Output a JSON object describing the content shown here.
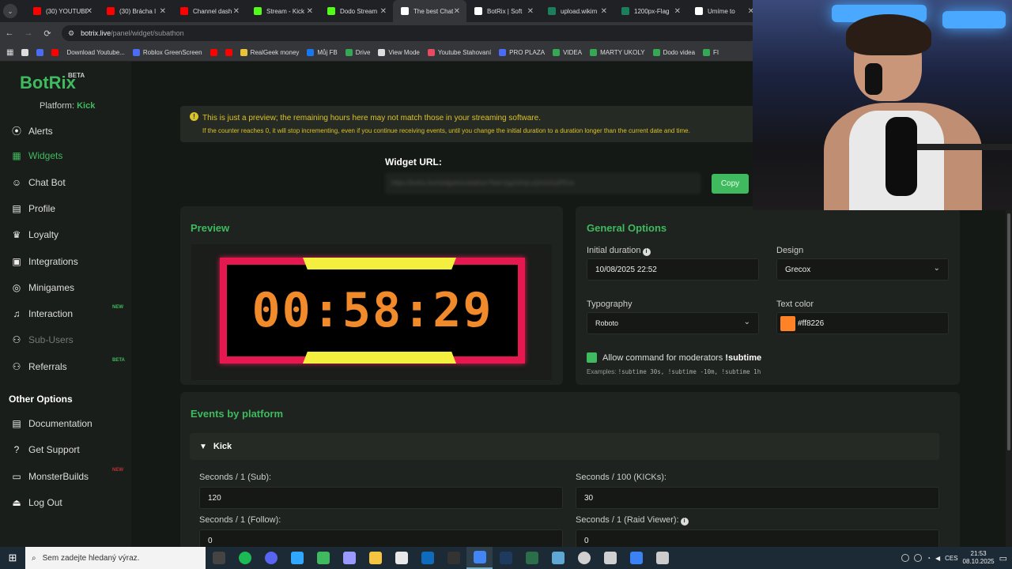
{
  "browser": {
    "tabs": [
      {
        "title": "(30) YOUTUBE",
        "color": "#ff0000",
        "active": false
      },
      {
        "title": "(30) Brácha I",
        "color": "#ff0000",
        "active": false
      },
      {
        "title": "Channel dash",
        "color": "#ff0000",
        "active": false
      },
      {
        "title": "Stream - Kick",
        "color": "#53fc18",
        "active": false
      },
      {
        "title": "Dodo Stream",
        "color": "#53fc18",
        "active": false
      },
      {
        "title": "The best Chat",
        "color": "#ffffff",
        "active": true
      },
      {
        "title": "BotRix | Soft",
        "color": "#ffffff",
        "active": false
      },
      {
        "title": "upload.wikim",
        "color": "#1a7f5a",
        "active": false
      },
      {
        "title": "1200px-Flag",
        "color": "#1a7f5a",
        "active": false
      },
      {
        "title": "Umíme to",
        "color": "#ffffff",
        "active": false
      }
    ],
    "tab_close": "✕",
    "url_host": "botrix.live",
    "url_path": "/panel/widget/subathon",
    "bookmarks": [
      {
        "label": "",
        "color": "#ddd"
      },
      {
        "label": "",
        "color": "#4a6cf7"
      },
      {
        "label": "",
        "color": "#ff0000"
      },
      {
        "label": "Download Youtube...",
        "color": ""
      },
      {
        "label": "Roblox GreenScreen",
        "color": "#4a6cf7"
      },
      {
        "label": "",
        "color": "#ff0000"
      },
      {
        "label": "",
        "color": "#ff0000"
      },
      {
        "label": "RealGeek money",
        "color": "#e8c33a"
      },
      {
        "label": "Můj FB",
        "color": "#1877f2"
      },
      {
        "label": "Drive",
        "color": "#34a853"
      },
      {
        "label": "View Mode",
        "color": "#ddd"
      },
      {
        "label": "Youtube Stahovaní",
        "color": "#e84a5f"
      },
      {
        "label": "PRO PLAZA",
        "color": "#4a6cf7"
      },
      {
        "label": "VIDEA",
        "color": "#34a853"
      },
      {
        "label": "MARTY UKOLY",
        "color": "#34a853"
      },
      {
        "label": "Dodo videa",
        "color": "#34a853"
      },
      {
        "label": "FI",
        "color": "#34a853"
      }
    ]
  },
  "sidebar": {
    "logo": "BotRix",
    "logo_badge": "BETA",
    "platform_label": "Platform:",
    "platform_value": "Kick",
    "items": [
      {
        "label": "Alerts",
        "icon": "⦿",
        "badge": ""
      },
      {
        "label": "Widgets",
        "icon": "▦",
        "badge": ""
      },
      {
        "label": "Chat Bot",
        "icon": "☺",
        "badge": ""
      },
      {
        "label": "Profile",
        "icon": "▤",
        "badge": ""
      },
      {
        "label": "Loyalty",
        "icon": "♛",
        "badge": ""
      },
      {
        "label": "Integrations",
        "icon": "▣",
        "badge": ""
      },
      {
        "label": "Minigames",
        "icon": "◎",
        "badge": ""
      },
      {
        "label": "Interaction",
        "icon": "♫",
        "badge": "NEW"
      },
      {
        "label": "Sub-Users",
        "icon": "⚇",
        "badge": ""
      },
      {
        "label": "Referrals",
        "icon": "⚇",
        "badge": "BETA"
      }
    ],
    "other_title": "Other Options",
    "other_items": [
      {
        "label": "Documentation",
        "icon": "▤",
        "badge": ""
      },
      {
        "label": "Get Support",
        "icon": "?",
        "badge": ""
      },
      {
        "label": "MonsterBuilds",
        "icon": "▭",
        "badge": "NEW"
      },
      {
        "label": "Log Out",
        "icon": "⏏",
        "badge": ""
      }
    ]
  },
  "notice": {
    "line1": "This is just a preview; the remaining hours here may not match those in your streaming software.",
    "line2": "If the counter reaches 0, it will stop incrementing, even if you continue receiving events, until you change the initial duration to a duration longer than the current date and time."
  },
  "widget_url": {
    "label": "Widget URL:",
    "value": "https://botrix.live/widgets/subathon?bid=QgZdXqLuQm2d1qPEne",
    "copy": "Copy"
  },
  "preview": {
    "title": "Preview",
    "timer": "00:58:29"
  },
  "general": {
    "title": "General Options",
    "initial_duration_label": "Initial duration",
    "initial_duration_value": "10/08/2025 22:52",
    "design_label": "Design",
    "design_value": "Grecox",
    "typography_label": "Typography",
    "typography_value": "Roboto",
    "text_color_label": "Text color",
    "text_color_value": "#ff8226",
    "allow_label": "Allow command for moderators",
    "allow_command": "!subtime",
    "examples_label": "Examples:",
    "examples": "!subtime 30s,  !subtime -10m, !subtime 1h"
  },
  "events": {
    "title": "Events by platform",
    "platform": "Kick",
    "fields": [
      {
        "label": "Seconds / 1 (Sub):",
        "value": "120"
      },
      {
        "label": "Seconds / 100 (KICKs):",
        "value": "30"
      },
      {
        "label": "Seconds / 1 (Follow):",
        "value": "0"
      },
      {
        "label": "Seconds / 1 (Raid Viewer):",
        "value": "0"
      }
    ]
  },
  "taskbar": {
    "search_placeholder": "Sem zadejte hledaný výraz.",
    "apps": [
      "#444",
      "#1db954",
      "#5865f2",
      "#31a8ff",
      "#3fba5e",
      "#9999ff",
      "#f5c542",
      "#e8e8e8",
      "#0f6cbd",
      "#333",
      "#4285f4",
      "#1e3a5f",
      "#2c6e49",
      "#5fa8d3",
      "#d0d0d0",
      "#d0d0d0",
      "#3b82f6",
      "#ccc"
    ],
    "lang": "CES",
    "time": "21:53",
    "date": "08.10.2025"
  }
}
